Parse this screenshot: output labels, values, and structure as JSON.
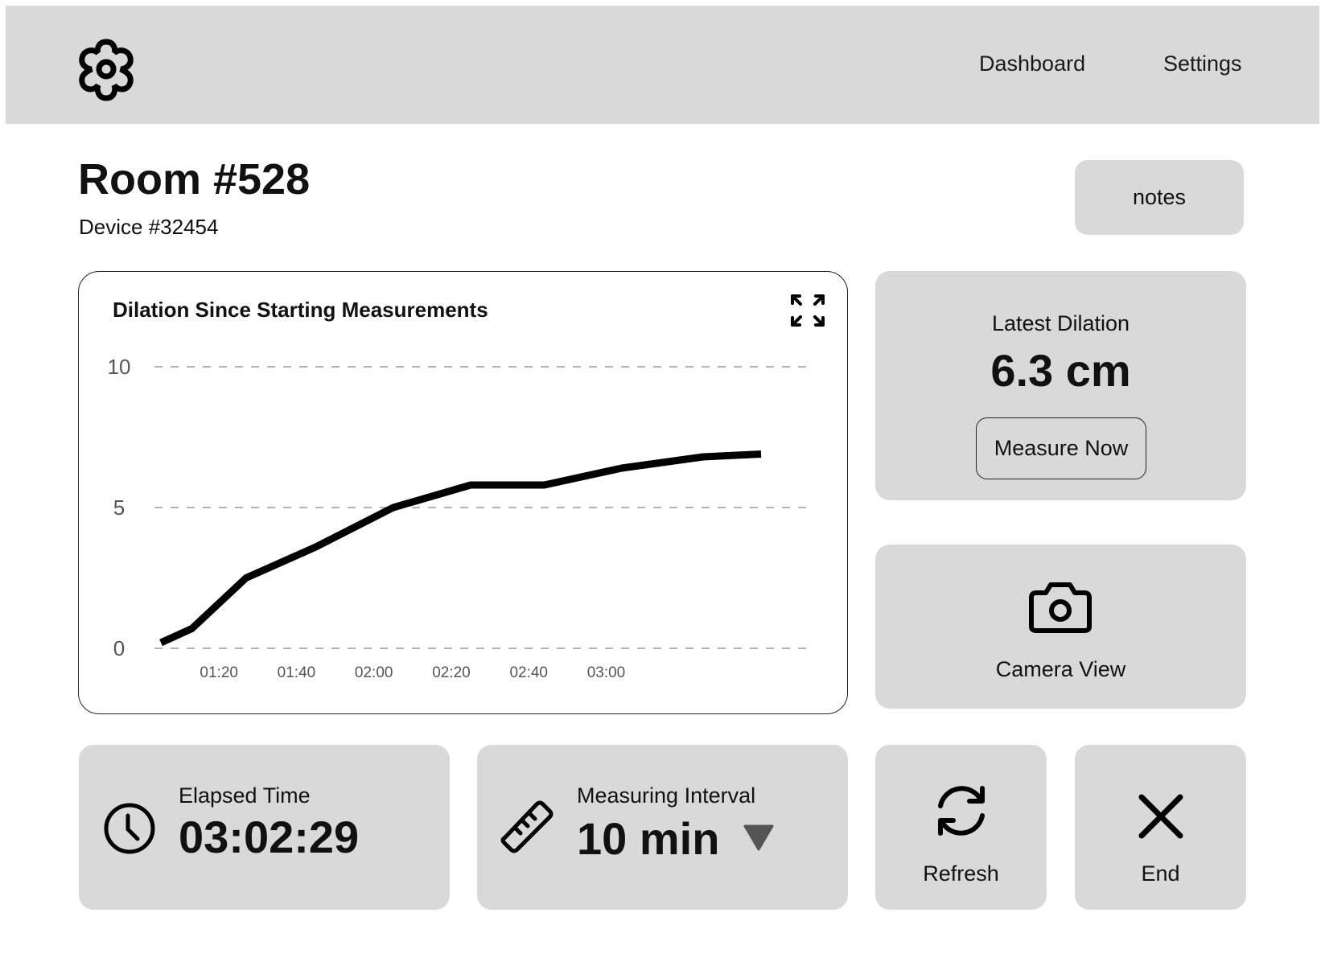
{
  "header": {
    "logo_icon": "flower-gear-icon",
    "nav": [
      {
        "label": "Dashboard"
      },
      {
        "label": "Settings"
      }
    ]
  },
  "room": {
    "title": "Room #528",
    "device": "Device #32454"
  },
  "notes_button": {
    "label": "notes"
  },
  "chart_card": {
    "expand_icon": "expand-icon"
  },
  "chart_data": {
    "type": "line",
    "title": "Dilation Since Starting Measurements",
    "xlabel": "",
    "ylabel": "",
    "x_unit": "minutes",
    "x": [
      65,
      73,
      87,
      105,
      125,
      145,
      164,
      184,
      205,
      220
    ],
    "x_ticks": [
      {
        "label": "01:20",
        "value": 80
      },
      {
        "label": "01:40",
        "value": 100
      },
      {
        "label": "02:00",
        "value": 120
      },
      {
        "label": "02:20",
        "value": 140
      },
      {
        "label": "02:40",
        "value": 160
      },
      {
        "label": "03:00",
        "value": 180
      }
    ],
    "series": [
      {
        "values": [
          0.2,
          0.7,
          2.5,
          3.6,
          5.0,
          5.8,
          5.8,
          6.4,
          6.8,
          6.9
        ]
      }
    ],
    "y_ticks": [
      {
        "label": "0",
        "value": 0
      },
      {
        "label": "5",
        "value": 5
      },
      {
        "label": "10",
        "value": 10
      }
    ],
    "ylim": [
      0,
      10
    ],
    "xlim": [
      65,
      220
    ],
    "grid": true,
    "colors": {
      "line": "#000000",
      "grid": "#9a9a9a"
    }
  },
  "latest": {
    "label": "Latest Dilation",
    "value": "6.3 cm",
    "button_label": "Measure Now"
  },
  "camera": {
    "icon": "camera-icon",
    "label": "Camera View"
  },
  "elapsed": {
    "icon": "clock-icon",
    "label": "Elapsed Time",
    "value": "03:02:29"
  },
  "interval": {
    "icon": "ruler-icon",
    "label": "Measuring Interval",
    "value": "10 min",
    "dropdown_icon": "triangle-down-icon"
  },
  "refresh": {
    "icon": "refresh-icon",
    "label": "Refresh"
  },
  "end": {
    "icon": "close-icon",
    "label": "End"
  },
  "colors": {
    "panel": "#d9d9d9",
    "text": "#111111",
    "dropdown": "#555555"
  }
}
